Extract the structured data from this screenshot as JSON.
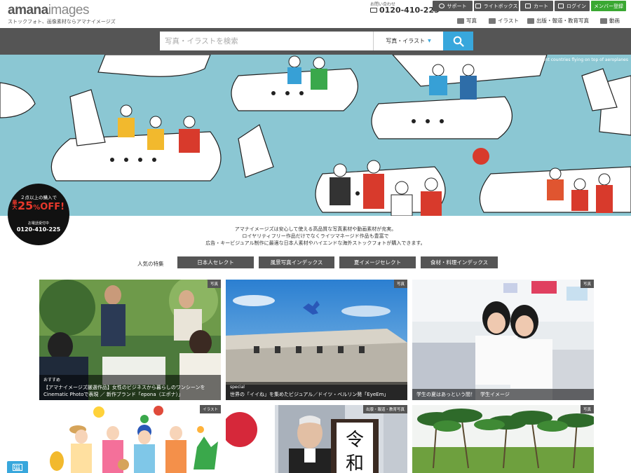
{
  "header": {
    "logo_bold": "amana",
    "logo_rest": "images",
    "tagline": "ストックフォト、画像素材ならアマナイメージズ",
    "phone_label": "お問い合わせ",
    "phone": "0120-410-225",
    "buttons": {
      "support": "サポート",
      "lightbox": "ライトボックス",
      "cart": "カート",
      "login": "ログイン",
      "member": "メンバー登録"
    },
    "categories": [
      "写真",
      "イラスト",
      "出版・報道・教育写真",
      "動画"
    ]
  },
  "search": {
    "placeholder": "写真・イラストを検索",
    "select_value": "写真・イラスト"
  },
  "hero": {
    "caption": "People from lots of different countries flying on top of aeroplanes",
    "colors": {
      "sky": "#8bc7d3",
      "plane": "#ffffff"
    }
  },
  "promo": {
    "line1": "２点以上の購入で",
    "big_left": "最大",
    "big": "25",
    "percent": "%",
    "off": "OFF!",
    "line3": "お電話受付中",
    "phone": "0120-410-225"
  },
  "intro": {
    "lines": [
      "アマナイメージズは安心して使える高品質な写真素材や動画素材が充実。",
      "ロイヤリティフリー作品だけでなくライツマネージド作品も豊富で",
      "広告・キービジュアル制作に最適な日本人素材やハイエンドな海外ストックフォトが購入できます。"
    ]
  },
  "popular": {
    "label": "人気の特集",
    "tags": [
      "日本人セレクト",
      "風景写真インデックス",
      "夏イメージセレクト",
      "食材・料理インデックス"
    ]
  },
  "cards": [
    {
      "badge": "写真",
      "kicker": "おすすめ",
      "caption": "【アマナイメージズ厳選作品】女性のビジネスから暮らしのワンシーンを Cinematic Photoで表現 ／ 新作ブランド「epona（エポナ）」"
    },
    {
      "badge": "写真",
      "kicker": "special",
      "caption": "世界の「イイね」を集めたビジュアル／ドイツ・ベルリン発「EyeEm」"
    },
    {
      "badge": "写真",
      "kicker": "",
      "caption": "学生の夏はあっという間！　学生イメージ"
    },
    {
      "badge": "イラスト",
      "kicker": "",
      "caption": ""
    },
    {
      "badge": "出版・報道・教育写真",
      "kicker": "",
      "caption": ""
    },
    {
      "badge": "写真",
      "kicker": "",
      "caption": ""
    }
  ],
  "brand_colors": {
    "accent": "#38a7dc",
    "member": "#3aa832",
    "dark": "#555555",
    "promo_red": "#e8382b"
  }
}
